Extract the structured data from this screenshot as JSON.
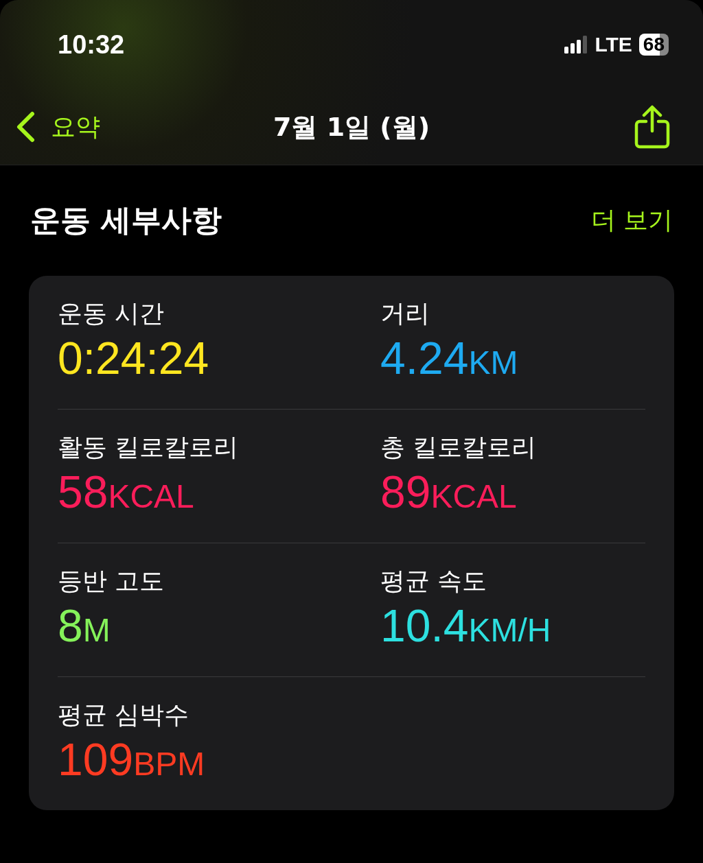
{
  "status_bar": {
    "time": "10:32",
    "network": "LTE",
    "battery": "68"
  },
  "nav": {
    "back_label": "요약",
    "title": "7월 1일 (월)"
  },
  "section": {
    "title": "운동 세부사항",
    "more": "더 보기"
  },
  "metrics": [
    {
      "label": "운동 시간",
      "value": "0:24:24",
      "color": "#ffe620"
    },
    {
      "label": "거리",
      "value": "4.24",
      "unit": "KM",
      "color": "#1eaaf1"
    },
    {
      "label": "활동 킬로칼로리",
      "value": "58",
      "unit": "KCAL",
      "color": "#fa1d5a"
    },
    {
      "label": "총 킬로칼로리",
      "value": "89",
      "unit": "KCAL",
      "color": "#fa1d5a"
    },
    {
      "label": "등반 고도",
      "value": "8",
      "unit": "M",
      "color": "#85f25a"
    },
    {
      "label": "평균 속도",
      "value": "10.4",
      "unit": "KM/H",
      "color": "#2de0e0"
    },
    {
      "label": "평균 심박수",
      "value": "109",
      "unit": "BPM",
      "color": "#ff3b22"
    }
  ]
}
